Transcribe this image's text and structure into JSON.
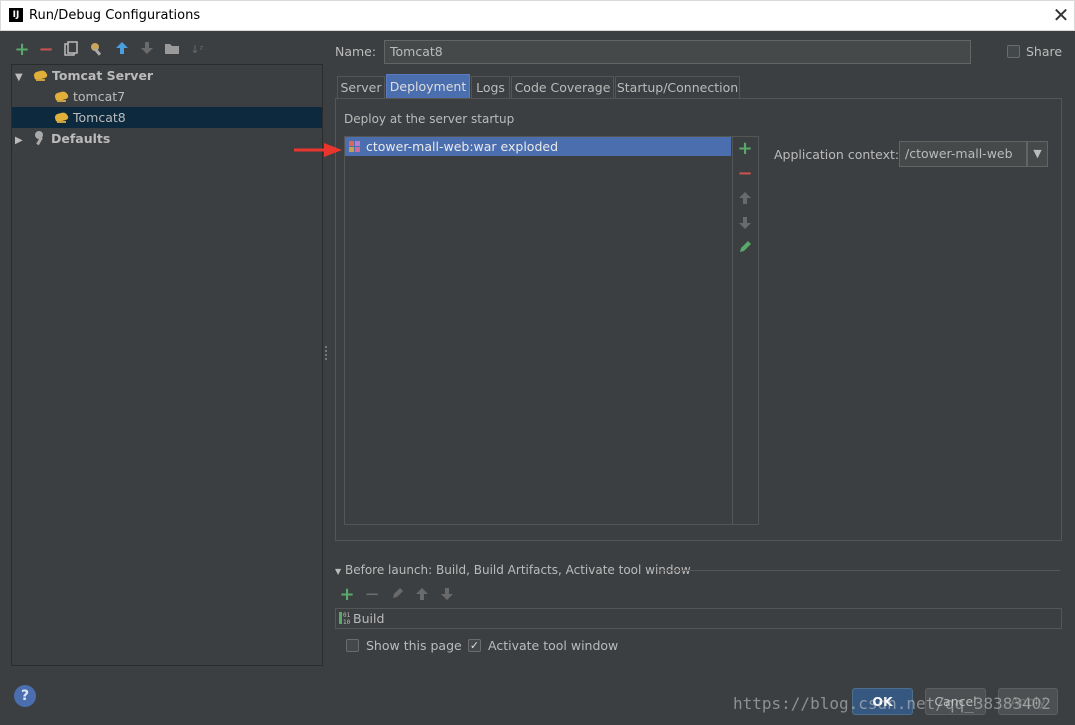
{
  "window": {
    "title": "Run/Debug Configurations",
    "logo": "IJ"
  },
  "toolbar": {
    "icons": [
      "add-icon",
      "remove-icon",
      "copy-icon",
      "wrench-icon",
      "move-up-icon",
      "move-down-icon",
      "folder-icon",
      "sort-icon"
    ]
  },
  "tree": {
    "group": "Tomcat Server",
    "items": [
      "tomcat7",
      "Tomcat8"
    ],
    "selected": "Tomcat8",
    "defaults": "Defaults"
  },
  "name": {
    "label": "Name:",
    "value": "Tomcat8"
  },
  "share": {
    "label": "Share",
    "checked": false
  },
  "tabs": [
    "Server",
    "Deployment",
    "Logs",
    "Code Coverage",
    "Startup/Connection"
  ],
  "active_tab": "Deployment",
  "deployment": {
    "heading": "Deploy at the server startup",
    "items": [
      "ctower-mall-web:war exploded"
    ],
    "app_context_label": "Application context:",
    "app_context_value": "/ctower-mall-web"
  },
  "before_launch": {
    "title": "Before launch: Build, Build Artifacts, Activate tool window",
    "tasks": [
      "Build"
    ],
    "show_page": {
      "label": "Show this page",
      "checked": false
    },
    "activate_tool_window": {
      "label": "Activate tool window",
      "checked": true
    }
  },
  "buttons": {
    "ok": "OK",
    "cancel": "Cancel",
    "apply": "Apply",
    "help": "?"
  },
  "watermark": "https://blog.csdn.net/qq_38383402",
  "colors": {
    "background": "#3c3f41",
    "selection": "#4b6eaf",
    "tree_selection": "#0d293e",
    "add": "#59a869",
    "remove": "#c75450",
    "arrow": "#e8352d"
  }
}
